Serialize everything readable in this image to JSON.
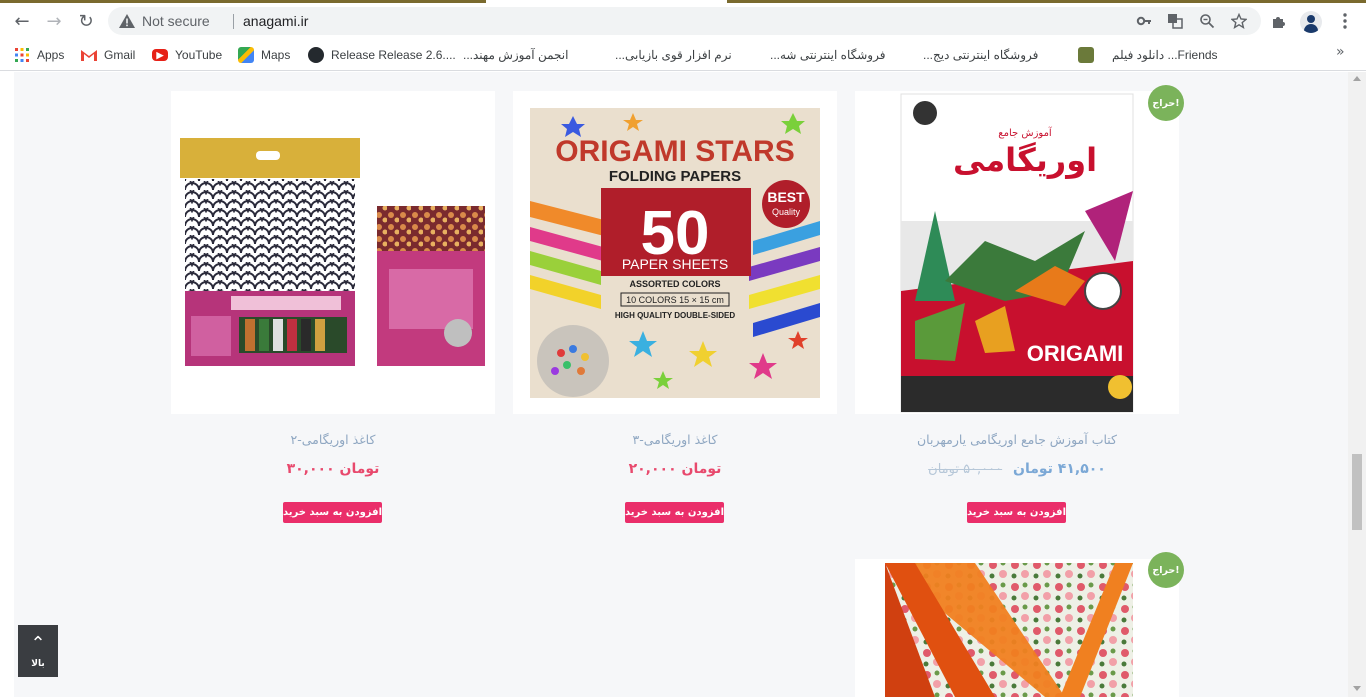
{
  "browser": {
    "security_text": "Not secure",
    "url": "anagami.ir"
  },
  "bookmarks": [
    {
      "label": "Apps",
      "icon": "apps-grid-icon"
    },
    {
      "label": "Gmail",
      "icon": "gmail-icon"
    },
    {
      "label": "YouTube",
      "icon": "youtube-icon"
    },
    {
      "label": "Maps",
      "icon": "maps-icon"
    },
    {
      "label": "Release Release 2.6....",
      "icon": "github-icon"
    },
    {
      "label": "انجمن آموزش مهند...",
      "icon": "bookmark-icon"
    },
    {
      "label": "نرم افزار قوی بازیابی...",
      "icon": "bookmark-icon"
    },
    {
      "label": "فروشگاه اینترنتی شه...",
      "icon": "bookmark-icon"
    },
    {
      "label": "فروشگاه اینترنتی دیج...",
      "icon": "bookmark-icon"
    },
    {
      "label": "دانلود فیلم ...Friends",
      "icon": "bookmark-icon"
    }
  ],
  "products": [
    {
      "title": "کاغذ اوریگامی-۲",
      "price": "۳۰,۰۰۰ تومان",
      "button": "افزودن به سبد خرید"
    },
    {
      "title": "کاغذ اوریگامی-۳",
      "price": "۲۰,۰۰۰ تومان",
      "button": "افزودن به سبد خرید",
      "image_text": {
        "headline": "ORIGAMI STARS",
        "sub": "FOLDING PAPERS",
        "count": "50",
        "sheets": "PAPER SHEETS",
        "assorted": "ASSORTED COLORS",
        "spec": "10 COLORS  15 × 15 cm",
        "quality": "HIGH QUALITY DOUBLE-SIDED",
        "badge_top": "BEST",
        "badge_bottom": "Quality"
      }
    },
    {
      "title": "کتاب آموزش جامع اوریگامی یارمهربان",
      "old_price": "۵۰,۰۰۰ تومان",
      "price": "۴۱,۵۰۰ تومان",
      "button": "افزودن به سبد خرید",
      "badge": "حراج!",
      "image_text": {
        "top_small": "آموزش جامع",
        "title_fa": "اوریگامی",
        "brand": "ORIGAMI"
      }
    },
    {
      "badge": "حراج!"
    }
  ],
  "back_to_top": "بالا",
  "colors": {
    "button": "#ea2e6a",
    "badge": "#7bb35b",
    "title": "#8fa7c2",
    "price": "#e8496d"
  }
}
